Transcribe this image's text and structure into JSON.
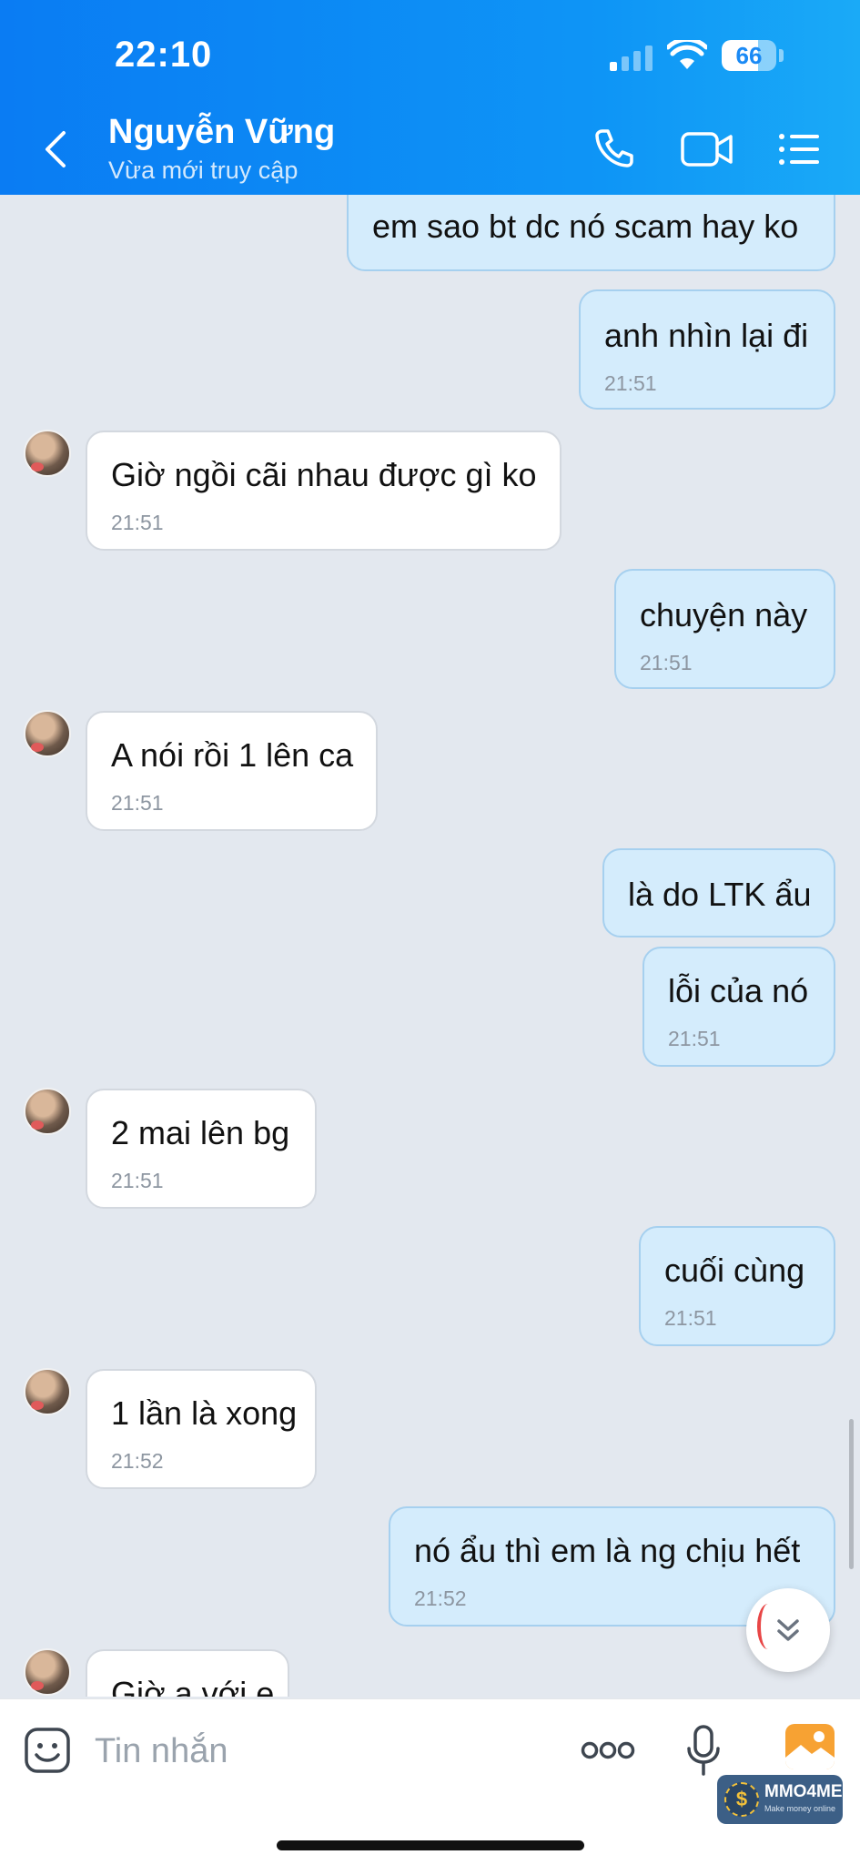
{
  "status_bar": {
    "time": "22:10",
    "battery": "66"
  },
  "header": {
    "name": "Nguyễn Vững",
    "status": "Vừa mới truy cập"
  },
  "messages": [
    {
      "text": "em sao bt dc nó scam hay ko",
      "time": ""
    },
    {
      "text": "anh nhìn lại đi",
      "time": "21:51"
    },
    {
      "text": "Giờ ngồi cãi nhau được gì ko",
      "time": "21:51"
    },
    {
      "text": "chuyện này",
      "time": "21:51"
    },
    {
      "text": "A nói rồi 1 lên ca",
      "time": "21:51"
    },
    {
      "text": "là do LTK ẩu",
      "time": ""
    },
    {
      "text": "lỗi của nó",
      "time": "21:51"
    },
    {
      "text": "2 mai lên bg",
      "time": "21:51"
    },
    {
      "text": "cuối cùng",
      "time": "21:51"
    },
    {
      "text": "1 lần là xong",
      "time": "21:52"
    },
    {
      "text": "nó ẩu thì em là ng chịu hết",
      "time": "21:52"
    },
    {
      "text": "Giờ a với e",
      "time": ""
    }
  ],
  "input": {
    "placeholder": "Tin nhắn"
  },
  "watermark": {
    "title": "MMO4ME",
    "subtitle": "Make money online"
  }
}
